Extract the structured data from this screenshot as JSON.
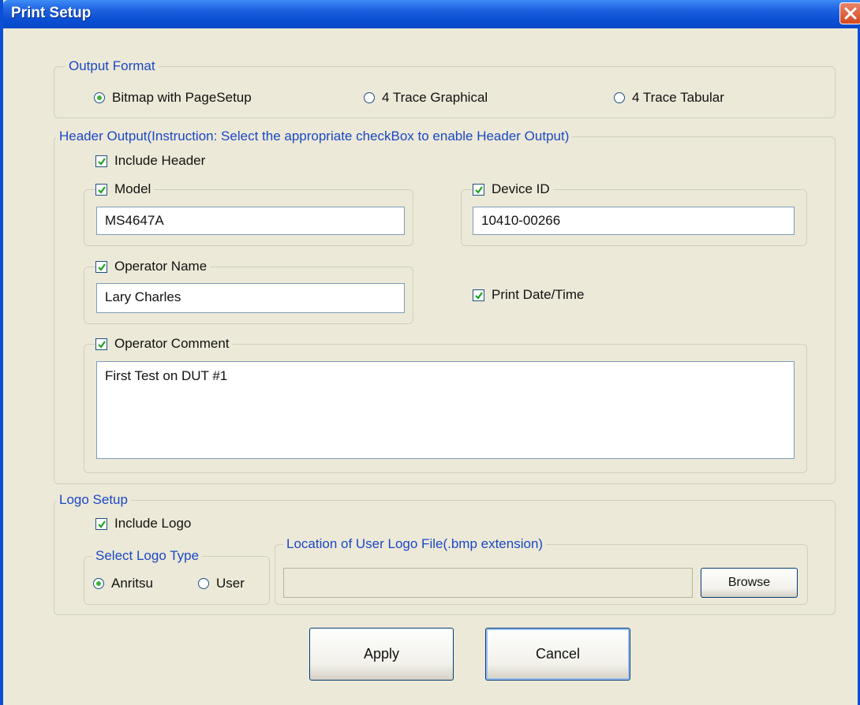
{
  "window": {
    "title": "Print Setup"
  },
  "output_format": {
    "legend": "Output Format",
    "options": [
      {
        "label": "Bitmap with PageSetup",
        "selected": true
      },
      {
        "label": "4 Trace Graphical",
        "selected": false
      },
      {
        "label": "4 Trace Tabular",
        "selected": false
      }
    ]
  },
  "header_output": {
    "legend": "Header Output(Instruction: Select the appropriate checkBox to enable Header Output)",
    "include_header": {
      "label": "Include Header",
      "checked": true
    },
    "model": {
      "label": "Model",
      "checked": true,
      "value": "MS4647A"
    },
    "device_id": {
      "label": "Device ID",
      "checked": true,
      "value": "10410-00266"
    },
    "operator_name": {
      "label": "Operator Name",
      "checked": true,
      "value": "Lary Charles"
    },
    "print_datetime": {
      "label": "Print Date/Time",
      "checked": true
    },
    "operator_comment": {
      "label": "Operator Comment",
      "checked": true,
      "value": "First Test on DUT #1"
    }
  },
  "logo_setup": {
    "legend": "Logo Setup",
    "include_logo": {
      "label": "Include Logo",
      "checked": true
    },
    "logo_type": {
      "legend": "Select Logo Type",
      "options": [
        {
          "label": "Anritsu",
          "selected": true
        },
        {
          "label": "User",
          "selected": false
        }
      ]
    },
    "location": {
      "legend": "Location of User Logo File(.bmp extension)",
      "value": ""
    },
    "browse_label": "Browse"
  },
  "buttons": {
    "apply": "Apply",
    "cancel": "Cancel"
  },
  "colors": {
    "titlebar": "#0a4fd3",
    "dialog_bg": "#ece9d8",
    "group_legend": "#1b48c4",
    "radio_dot": "#3fb13d"
  }
}
